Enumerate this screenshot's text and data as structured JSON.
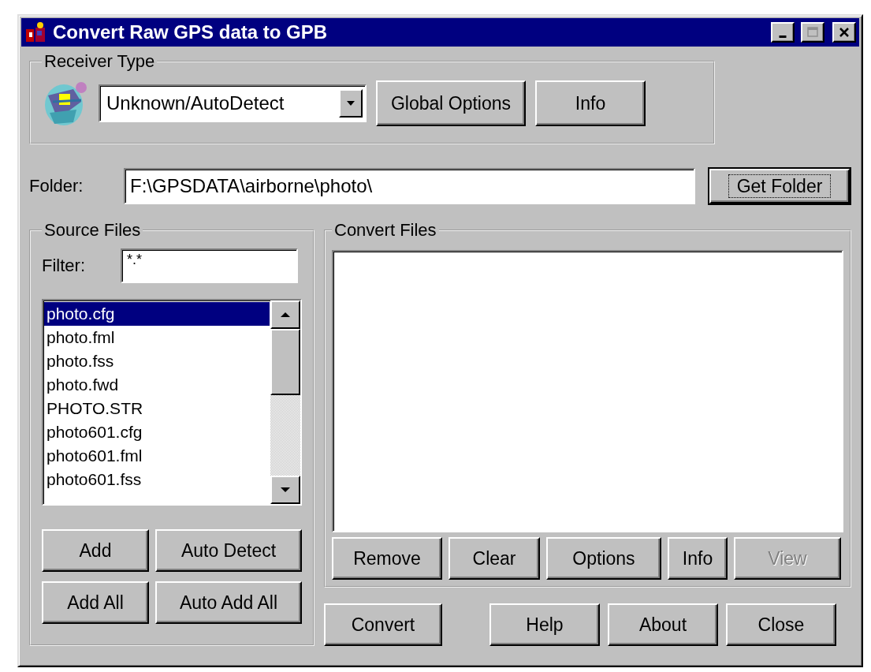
{
  "window": {
    "title": "Convert Raw GPS data to GPB",
    "controls": [
      {
        "kind": "minimize",
        "disabled": false
      },
      {
        "kind": "maximize",
        "disabled": true
      },
      {
        "kind": "close",
        "disabled": false
      }
    ]
  },
  "receiver_type": {
    "label": "Receiver Type",
    "dropdown": {
      "value": "Unknown/AutoDetect"
    },
    "buttons": [
      {
        "label": "Global Options"
      },
      {
        "label": "Info"
      }
    ]
  },
  "folder": {
    "label": "Folder:",
    "value": "F:\\GPSDATA\\airborne\\photo\\",
    "button": {
      "label": "Get Folder",
      "default": true
    }
  },
  "source_files": {
    "label": "Source Files",
    "filter": {
      "label": "Filter:",
      "value": "*.*"
    },
    "files": [
      {
        "name": "photo.cfg",
        "selected": true
      },
      {
        "name": "photo.fml",
        "selected": false
      },
      {
        "name": "photo.fss",
        "selected": false
      },
      {
        "name": "photo.fwd",
        "selected": false
      },
      {
        "name": "PHOTO.STR",
        "selected": false
      },
      {
        "name": "photo601.cfg",
        "selected": false
      },
      {
        "name": "photo601.fml",
        "selected": false
      },
      {
        "name": "photo601.fss",
        "selected": false
      }
    ],
    "buttons": [
      {
        "label": "Add"
      },
      {
        "label": "Auto Detect"
      },
      {
        "label": "Add All"
      },
      {
        "label": "Auto Add All"
      }
    ]
  },
  "convert_files": {
    "label": "Convert Files",
    "buttons": [
      {
        "label": "Remove",
        "disabled": false
      },
      {
        "label": "Clear",
        "disabled": false
      },
      {
        "label": "Options",
        "disabled": false
      },
      {
        "label": "Info",
        "disabled": false
      },
      {
        "label": "View",
        "disabled": true
      }
    ]
  },
  "footer_buttons": [
    {
      "label": "Convert"
    },
    {
      "label": "Help"
    },
    {
      "label": "About"
    },
    {
      "label": "Close"
    }
  ]
}
